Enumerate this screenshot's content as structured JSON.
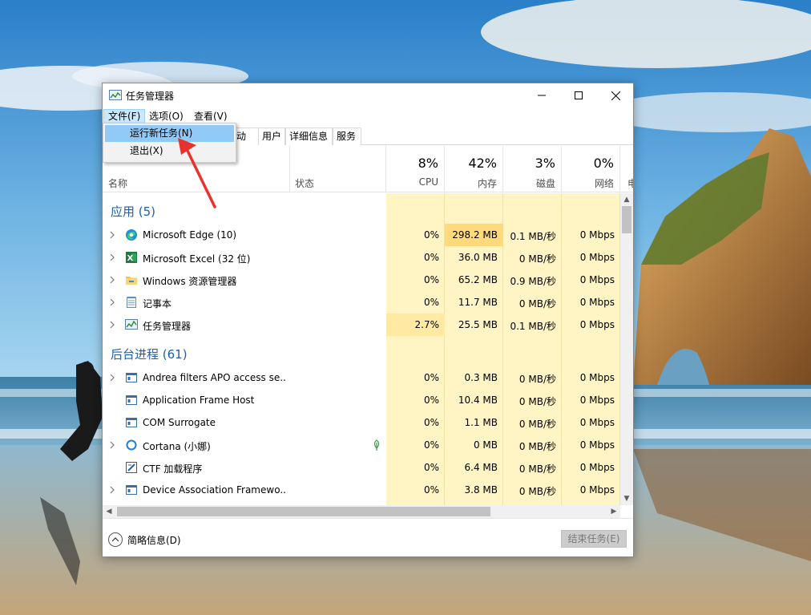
{
  "window": {
    "title": "任务管理器"
  },
  "menu": {
    "file": "文件(F)",
    "options": "选项(O)",
    "view": "查看(V)"
  },
  "file_menu": {
    "run_new_task": "运行新任务(N)",
    "exit": "退出(X)"
  },
  "tabs": {
    "startup": "启动",
    "users": "用户",
    "details": "详细信息",
    "services": "服务"
  },
  "header": {
    "name": "名称",
    "status": "状态",
    "cpu_pct": "8%",
    "cpu": "CPU",
    "mem_pct": "42%",
    "mem": "内存",
    "disk_pct": "3%",
    "disk": "磁盘",
    "net_pct": "0%",
    "net": "网络",
    "power": "电"
  },
  "groups": {
    "apps": "应用 (5)",
    "background": "后台进程 (61)"
  },
  "apps": [
    {
      "name": "Microsoft Edge (10)",
      "cpu": "0%",
      "mem": "298.2 MB",
      "disk": "0.1 MB/秒",
      "net": "0 Mbps",
      "icon": "edge-icon"
    },
    {
      "name": "Microsoft Excel (32 位)",
      "cpu": "0%",
      "mem": "36.0 MB",
      "disk": "0 MB/秒",
      "net": "0 Mbps",
      "icon": "excel-icon"
    },
    {
      "name": "Windows 资源管理器",
      "cpu": "0%",
      "mem": "65.2 MB",
      "disk": "0.9 MB/秒",
      "net": "0 Mbps",
      "icon": "folder-icon"
    },
    {
      "name": "记事本",
      "cpu": "0%",
      "mem": "11.7 MB",
      "disk": "0 MB/秒",
      "net": "0 Mbps",
      "icon": "notepad-icon"
    },
    {
      "name": "任务管理器",
      "cpu": "2.7%",
      "mem": "25.5 MB",
      "disk": "0.1 MB/秒",
      "net": "0 Mbps",
      "icon": "task-manager-icon"
    }
  ],
  "background": [
    {
      "name": "Andrea filters APO access se...",
      "cpu": "0%",
      "mem": "0.3 MB",
      "disk": "0 MB/秒",
      "net": "0 Mbps",
      "icon": "service-icon"
    },
    {
      "name": "Application Frame Host",
      "cpu": "0%",
      "mem": "10.4 MB",
      "disk": "0 MB/秒",
      "net": "0 Mbps",
      "icon": "service-icon"
    },
    {
      "name": "COM Surrogate",
      "cpu": "0%",
      "mem": "1.1 MB",
      "disk": "0 MB/秒",
      "net": "0 Mbps",
      "icon": "service-icon"
    },
    {
      "name": "Cortana (小娜)",
      "cpu": "0%",
      "mem": "0 MB",
      "disk": "0 MB/秒",
      "net": "0 Mbps",
      "icon": "cortana-icon"
    },
    {
      "name": "CTF 加载程序",
      "cpu": "0%",
      "mem": "6.4 MB",
      "disk": "0 MB/秒",
      "net": "0 Mbps",
      "icon": "ctf-icon"
    },
    {
      "name": "Device Association Framewo...",
      "cpu": "0%",
      "mem": "3.8 MB",
      "disk": "0 MB/秒",
      "net": "0 Mbps",
      "icon": "service-icon"
    }
  ],
  "footer": {
    "fewer_details": "简略信息(D)",
    "end_task": "结束任务(E)"
  },
  "colors": {
    "accent": "#1e5faa",
    "heat_light": "#fff4c4",
    "heat_strong": "#ffe9a3",
    "menu_highlight": "#91c9f7",
    "annotation_arrow": "#e8322e"
  }
}
